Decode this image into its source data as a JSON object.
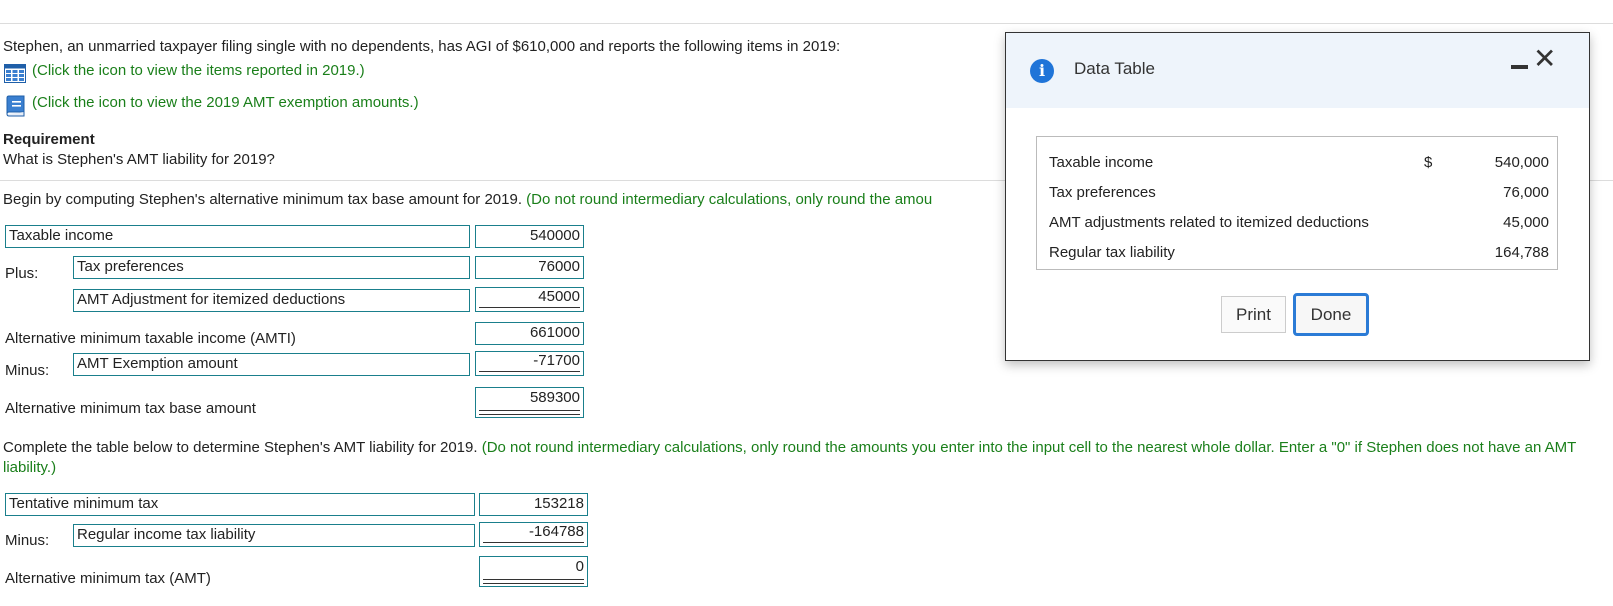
{
  "intro": {
    "question": "Stephen, an unmarried taxpayer filing single with no dependents, has AGI of $610,000 and reports the following items in 2019:",
    "link_items": "(Click the icon to view the items reported in 2019.)",
    "link_exemption": "(Click the icon to view the 2019 AMT exemption amounts.)",
    "requirement_title": "Requirement",
    "requirement_text": "What is Stephen's AMT liability for 2019?"
  },
  "part1": {
    "instruction": "Begin by computing Stephen's alternative minimum tax base amount for 2019.",
    "instruction_note": "(Do not round intermediary calculations, only round the amou",
    "rows": {
      "taxable_income": {
        "label": "Taxable income",
        "value": "540000"
      },
      "plus_label": "Plus:",
      "tax_preferences": {
        "label": "Tax preferences",
        "value": "76000"
      },
      "amt_adjustment": {
        "label": "AMT Adjustment for itemized deductions",
        "value": "45000"
      },
      "amti": {
        "label": "Alternative minimum taxable income (AMTI)",
        "value": "661000"
      },
      "minus_label": "Minus:",
      "exemption": {
        "label": "AMT Exemption amount",
        "value": "-71700"
      },
      "base_amount": {
        "label": "Alternative minimum tax base amount",
        "value": "589300"
      }
    }
  },
  "part2": {
    "instruction": "Complete the table below to determine Stephen's AMT liability for 2019.",
    "instruction_note": "(Do not round intermediary calculations, only round the amounts you enter into the input cell to the nearest whole dollar. Enter a \"0\" if Stephen does not have an AMT liability.)",
    "rows": {
      "tentative": {
        "label": "Tentative minimum tax",
        "value": "153218"
      },
      "minus_label": "Minus:",
      "regular": {
        "label": "Regular income tax liability",
        "value": "-164788"
      },
      "amt": {
        "label": "Alternative minimum tax (AMT)",
        "value": "0"
      }
    }
  },
  "modal": {
    "title": "Data Table",
    "icon": "info-icon",
    "rows": [
      {
        "label": "Taxable income",
        "dollar": "$",
        "value": "540,000"
      },
      {
        "label": "Tax preferences",
        "dollar": "",
        "value": "76,000"
      },
      {
        "label": "AMT adjustments related to itemized deductions",
        "dollar": "",
        "value": "45,000"
      },
      {
        "label": "Regular tax liability",
        "dollar": "",
        "value": "164,788"
      }
    ],
    "print_label": "Print",
    "done_label": "Done"
  },
  "colors": {
    "accent_green": "#1a7f1a",
    "input_border": "#1a7f8c",
    "modal_header": "#eef4fb",
    "focus_blue": "#2b7bd6"
  }
}
